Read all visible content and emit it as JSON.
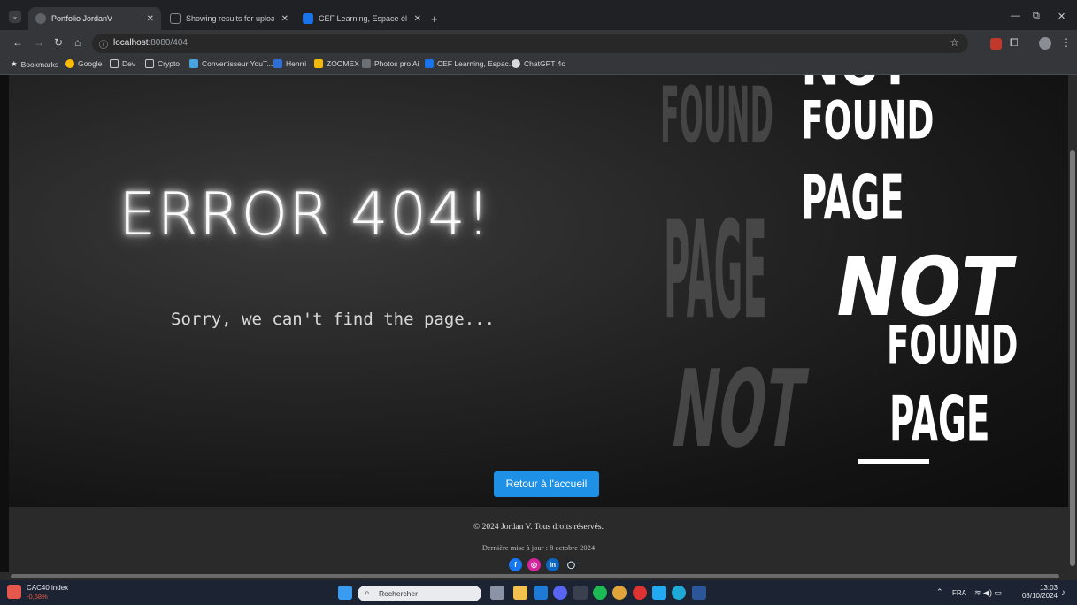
{
  "browser": {
    "tabs": [
      {
        "title": "Portfolio JordanV",
        "active": true
      },
      {
        "title": "Showing results for uploaded fi",
        "active": false
      },
      {
        "title": "CEF Learning, Espace élève du (",
        "active": false
      }
    ],
    "new_tab": "+",
    "address": {
      "host": "localhost",
      "path": ":8080/404"
    },
    "bookmarks": [
      {
        "label": "Bookmarks",
        "icon": "star-icon"
      },
      {
        "label": "Google",
        "icon": "google-icon"
      },
      {
        "label": "Dev",
        "icon": "folder-icon"
      },
      {
        "label": "Crypto",
        "icon": "folder-icon"
      },
      {
        "label": "Convertisseur YouT...",
        "icon": "convert-icon"
      },
      {
        "label": "Henrri",
        "icon": "henrri-icon"
      },
      {
        "label": "ZOOMEX",
        "icon": "zoomex-icon"
      },
      {
        "label": "Photos pro Ai",
        "icon": "photo-icon"
      },
      {
        "label": "CEF Learning, Espac...",
        "icon": "cef-icon"
      },
      {
        "label": "ChatGPT 4o",
        "icon": "chatgpt-icon"
      }
    ]
  },
  "page": {
    "error_title": "ERROR 404!",
    "message": "Sorry, we can't find the page...",
    "art_words": {
      "found": "FOUND",
      "page": "PAGE",
      "not": "NOT"
    },
    "home_button": "Retour à l'accueil",
    "footer": {
      "copyright": "© 2024 Jordan V. Tous droits réservés.",
      "updated": "Dernière mise à jour : 8 octobre 2024",
      "socials": [
        {
          "name": "facebook",
          "glyph": "f",
          "color": "#1877f2"
        },
        {
          "name": "instagram",
          "glyph": "◎",
          "color": "#d6249f"
        },
        {
          "name": "linkedin",
          "glyph": "in",
          "color": "#0a66c2"
        },
        {
          "name": "github",
          "glyph": "◯",
          "color": "#24292e"
        }
      ]
    }
  },
  "taskbar": {
    "stock_name": "CAC40 index",
    "stock_change": "-0,68%",
    "search_placeholder": "Rechercher",
    "lang": "FRA",
    "time": "13:03",
    "date": "08/10/2024"
  },
  "colors": {
    "accent_button": "#1e90e6",
    "stock_down": "#e6584b"
  }
}
